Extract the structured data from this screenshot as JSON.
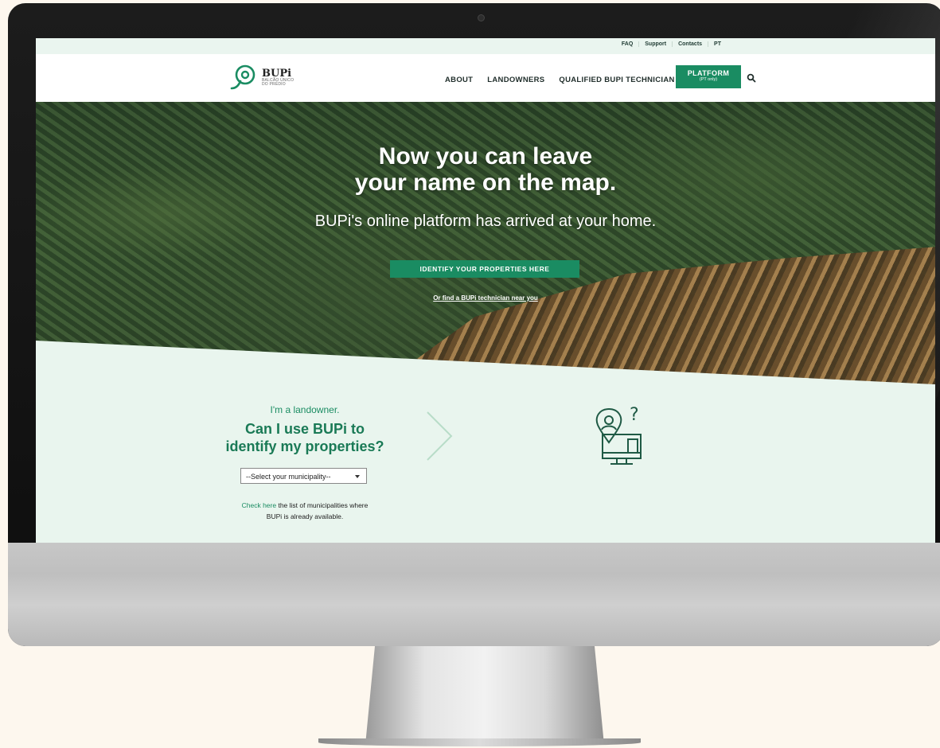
{
  "topbar": {
    "links": [
      {
        "label": "FAQ"
      },
      {
        "label": "Support"
      },
      {
        "label": "Contacts"
      },
      {
        "label": "PT"
      }
    ]
  },
  "logo": {
    "name": "BUPi",
    "subtitle_line1": "BALCÃO ÚNICO",
    "subtitle_line2": "DO PRÉDIO"
  },
  "nav": {
    "items": [
      {
        "label": "ABOUT"
      },
      {
        "label": "LANDOWNERS"
      },
      {
        "label": "QUALIFIED BUPI TECHNICIAN"
      }
    ],
    "platform_label": "PLATFORM",
    "platform_sub": "(PT only)"
  },
  "hero": {
    "title_line1": "Now you can leave",
    "title_line2": "your name on the map.",
    "subtitle": "BUPi's online platform has arrived at your home.",
    "cta": "IDENTIFY YOUR PROPERTIES HERE",
    "link": "Or find a BUPi technician near you"
  },
  "landowner": {
    "intro": "I'm a landowner.",
    "question_line1": "Can I use BUPi to",
    "question_line2": "identify my properties?",
    "select_value": "--Select your municipality--",
    "check_link": "Check here",
    "check_text": " the list of municipalities where",
    "check_text2": "BUPi is already available."
  },
  "colors": {
    "brand_green": "#1a8c62",
    "light_green_bg": "#e9f5ee"
  },
  "icons": [
    "search-icon",
    "logo-pin-icon",
    "chevron-right-icon",
    "user-pin-monitor-icon",
    "caret-down-icon"
  ]
}
